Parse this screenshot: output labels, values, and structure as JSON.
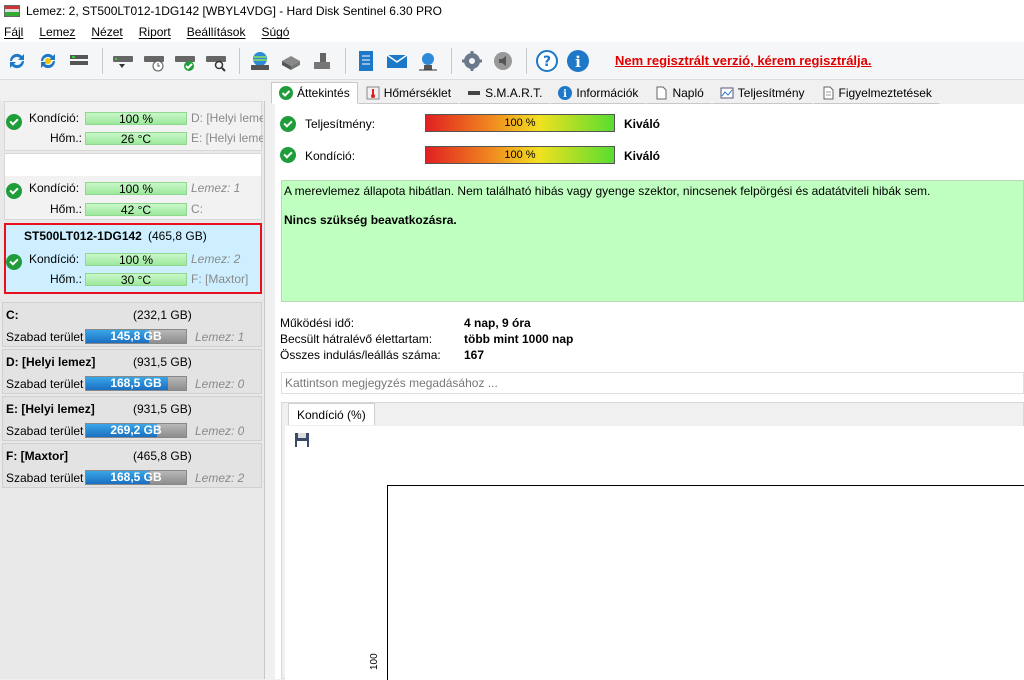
{
  "window": {
    "title": "Lemez: 2, ST500LT012-1DG142 [WBYL4VDG]  -  Hard Disk Sentinel 6.30 PRO"
  },
  "menu": [
    "Fájl",
    "Lemez",
    "Nézet",
    "Riport",
    "Beállítások",
    "Súgó"
  ],
  "toolbar": {
    "icons": [
      "refresh-icon",
      "refresh-all-icon",
      "disk-info-icon",
      "disk-test-icon",
      "disk-schedule-icon",
      "disk-ok-icon",
      "disk-search-icon",
      "network-icon",
      "usb-disk-icon",
      "external-disk-icon",
      "notes-icon",
      "email-icon",
      "network-share-icon",
      "settings-icon",
      "sound-icon",
      "help-icon",
      "info-icon"
    ],
    "registration_text": "Nem regisztrált verzió, kérem regisztrálja."
  },
  "disks": [
    {
      "cond_label": "Kondíció:",
      "cond_val": "100 %",
      "cond_side": "D: [Helyi leme",
      "temp_label": "Hőm.:",
      "temp_val": "26 °C",
      "temp_side": "E: [Helyi leme"
    },
    {
      "cond_label": "Kondíció:",
      "cond_val": "100 %",
      "cond_side": "Lemez: 1",
      "temp_label": "Hőm.:",
      "temp_val": "42 °C",
      "temp_side": "C:"
    },
    {
      "name": "ST500LT012-1DG142",
      "size": "(465,8 GB)",
      "cond_label": "Kondíció:",
      "cond_val": "100 %",
      "cond_side": "Lemez: 2",
      "temp_label": "Hőm.:",
      "temp_val": "30 °C",
      "temp_side": "F: [Maxtor]"
    }
  ],
  "partitions": [
    {
      "name": "C:",
      "size": "(232,1 GB)",
      "free_label": "Szabad terület",
      "free": "145,8 GB",
      "fill": 0.63,
      "disk": "Lemez: 1"
    },
    {
      "name": "D: [Helyi lemez]",
      "size": "(931,5 GB)",
      "free_label": "Szabad terület",
      "free": "168,5 GB",
      "fill": 0.82,
      "disk": "Lemez: 0"
    },
    {
      "name": "E: [Helyi lemez]",
      "size": "(931,5 GB)",
      "free_label": "Szabad terület",
      "free": "269,2 GB",
      "fill": 0.71,
      "disk": "Lemez: 0"
    },
    {
      "name": "F: [Maxtor]",
      "size": "(465,8 GB)",
      "free_label": "Szabad terület",
      "free": "168,5 GB",
      "fill": 0.64,
      "disk": "Lemez: 2"
    }
  ],
  "tabs": [
    "Áttekintés",
    "Hőmérséklet",
    "S.M.A.R.T.",
    "Információk",
    "Napló",
    "Teljesítmény",
    "Figyelmeztetések"
  ],
  "overview": {
    "perf_label": "Teljesítmény:",
    "perf_val": "100 %",
    "perf_rating": "Kiváló",
    "cond_label": "Kondíció:",
    "cond_val": "100 %",
    "cond_rating": "Kiváló",
    "status_text": "A merevlemez állapota hibátlan. Nem található hibás vagy gyenge szektor, nincsenek felpörgési és adatátviteli hibák sem.",
    "status_action": "Nincs szükség beavatkozásra.",
    "uptime_label": "Működési idő:",
    "uptime_val": "4 nap, 9 óra",
    "life_label": "Becsült hátralévő élettartam:",
    "life_val": "több mint 1000 nap",
    "starts_label": "Összes indulás/leállás száma:",
    "starts_val": "167",
    "note_placeholder": "Kattintson megjegyzés megadásához ...",
    "chart_tab": "Kondíció  (%)",
    "chart_ytick": "100"
  },
  "colors": {
    "accent": "#1a6fc0",
    "ok_green": "#1f9d3a",
    "status_bg": "#bfffbf",
    "selection_border": "#e8101c"
  }
}
